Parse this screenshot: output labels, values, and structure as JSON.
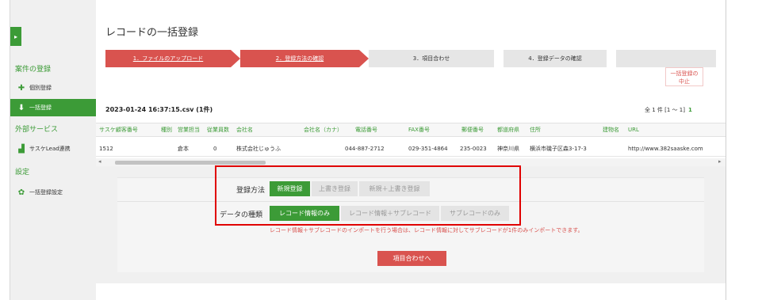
{
  "sidebar": {
    "toggle_icon": "chevron-right-icon",
    "sections": [
      {
        "label": "案件の登録"
      },
      {
        "label": "外部サービス"
      },
      {
        "label": "設定"
      }
    ],
    "items": [
      {
        "label": "個別登録",
        "icon": "plus-icon",
        "glyph": "✚"
      },
      {
        "label": "一括登録",
        "icon": "bulk-import-icon",
        "glyph": "⬇"
      },
      {
        "label": "サスケLead連携",
        "icon": "integration-icon",
        "glyph": "▟"
      },
      {
        "label": "一括登録設定",
        "icon": "gear-icon",
        "glyph": "✿"
      }
    ]
  },
  "page": {
    "title": "レコードの一括登録"
  },
  "steps": [
    {
      "label": "1．ファイルのアップロード",
      "state": "done"
    },
    {
      "label": "2．登録方法の確認",
      "state": "done"
    },
    {
      "label": "3．項目合わせ",
      "state": "todo"
    },
    {
      "label": "4．登録データの確認",
      "state": "todo"
    }
  ],
  "cancel": {
    "line1": "一括登録の",
    "line2": "中止"
  },
  "file": {
    "name": "2023-01-24 16:37:15.csv (1件)"
  },
  "count": {
    "summary": "全 1 件 [1 ～ 1]",
    "page": "1"
  },
  "table": {
    "headers": [
      "サスケ顧客番号",
      "種別",
      "営業担当",
      "従業員数",
      "会社名",
      "会社名（カナ）",
      "電話番号",
      "FAX番号",
      "郵便番号",
      "都道府県",
      "住所",
      "建物名",
      "URL"
    ],
    "rows": [
      [
        "1512",
        "",
        "倉本",
        "0",
        "株式会社じゅうふ",
        "",
        "044-887-2712",
        "029-351-4864",
        "235-0023",
        "神奈川県",
        "横浜市磯子区森3-17-3",
        "",
        "http://www.382saaske.com"
      ]
    ]
  },
  "settings": {
    "method_label": "登録方法",
    "method_options": [
      {
        "label": "新規登録",
        "selected": true
      },
      {
        "label": "上書き登録",
        "selected": false
      },
      {
        "label": "新規＋上書き登録",
        "selected": false
      }
    ],
    "type_label": "データの種類",
    "type_options": [
      {
        "label": "レコード情報のみ",
        "selected": true
      },
      {
        "label": "レコード情報＋サブレコード",
        "selected": false
      },
      {
        "label": "サブレコードのみ",
        "selected": false
      }
    ],
    "note": "レコード情報＋サブレコードのインポートを行う場合は、レコード情報に対してサブレコードが1件のみインポートできます。"
  },
  "next_button": {
    "label": "項目合わせへ"
  },
  "colors": {
    "accent": "#3c9b37",
    "danger": "#d9534f",
    "highlight": "#e00000"
  }
}
